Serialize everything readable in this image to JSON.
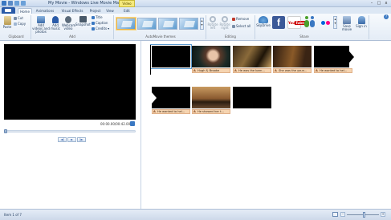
{
  "window": {
    "title": "My Movie - Windows Live Movie Maker",
    "context_tab": "Video Tools",
    "controls": {
      "minimize": "–",
      "maximize": "□",
      "close": "x"
    }
  },
  "tabs": [
    {
      "label": "Home",
      "active": true
    },
    {
      "label": "Animations",
      "active": false
    },
    {
      "label": "Visual Effects",
      "active": false
    },
    {
      "label": "Project",
      "active": false
    },
    {
      "label": "View",
      "active": false
    },
    {
      "label": "Edit",
      "active": false
    }
  ],
  "ribbon": {
    "clipboard": {
      "group": "Clipboard",
      "paste": "Paste",
      "cut": "Cut",
      "copy": "Copy"
    },
    "add": {
      "group": "Add",
      "add_videos": "Add videos and photos",
      "add_music": "Add music",
      "webcam": "Webcam video",
      "snapshot": "Snapshot",
      "title": "Title",
      "caption": "Caption",
      "credits": "Credits"
    },
    "themes": {
      "group": "AutoMovie themes"
    },
    "editing": {
      "group": "Editing",
      "rotate_left": "Rotate left",
      "rotate_right": "Rotate right",
      "remove": "Remove",
      "select_all": "Select all"
    },
    "share": {
      "group": "Share",
      "skydrive": "SkyDrive",
      "save_movie": "Save movie",
      "sign_in": "Sign in"
    }
  },
  "preview": {
    "timecode": "00:00.00/00:42.00",
    "buttons": {
      "previous": "◄|",
      "play": "►",
      "next": "|►"
    }
  },
  "storyboard": {
    "row1_captions": [
      "Hugh & Brooke",
      "He was the barn...",
      "She was the youn...",
      "He wanted to hel..."
    ],
    "row2_captions": [
      "He wanted to hel...",
      "He showed her t..."
    ]
  },
  "status": {
    "items": "Item 1 of 7",
    "zoom_out": "–",
    "zoom_in": "+"
  },
  "colors": {
    "accent": "#2a5ba8",
    "caption_bg": "#f6d4b0",
    "ribbon_bg": "#e4ecf6"
  }
}
